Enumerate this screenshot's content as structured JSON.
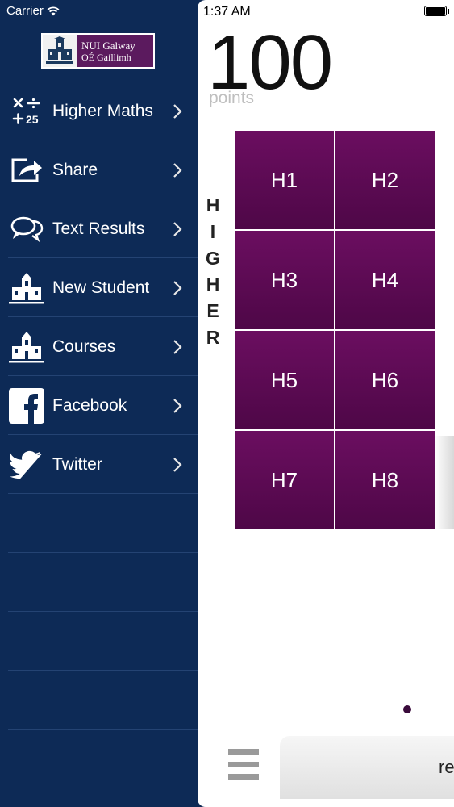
{
  "status": {
    "carrier": "Carrier",
    "time": "1:37 AM"
  },
  "logo": {
    "line1": "NUI Galway",
    "line2": "OÉ Gaillimh"
  },
  "menu": {
    "items": [
      {
        "label": "Higher Maths",
        "icon": "math-operators-icon"
      },
      {
        "label": "Share",
        "icon": "share-icon"
      },
      {
        "label": "Text Results",
        "icon": "speech-bubbles-icon"
      },
      {
        "label": "New Student",
        "icon": "building-icon"
      },
      {
        "label": "Courses",
        "icon": "building-icon"
      },
      {
        "label": "Facebook",
        "icon": "facebook-icon"
      },
      {
        "label": "Twitter",
        "icon": "twitter-icon"
      }
    ]
  },
  "main": {
    "points_value": "100",
    "points_label": "points",
    "level_letters": [
      "H",
      "I",
      "G",
      "H",
      "E",
      "R"
    ],
    "grades": [
      "H1",
      "H2",
      "H3",
      "H4",
      "H5",
      "H6",
      "H7",
      "H8"
    ],
    "bottom_button_text": "re"
  },
  "colors": {
    "menu_bg": "#0d2a56",
    "grade_purple": "#5e0b56",
    "logo_purple": "#5b1a5e"
  }
}
